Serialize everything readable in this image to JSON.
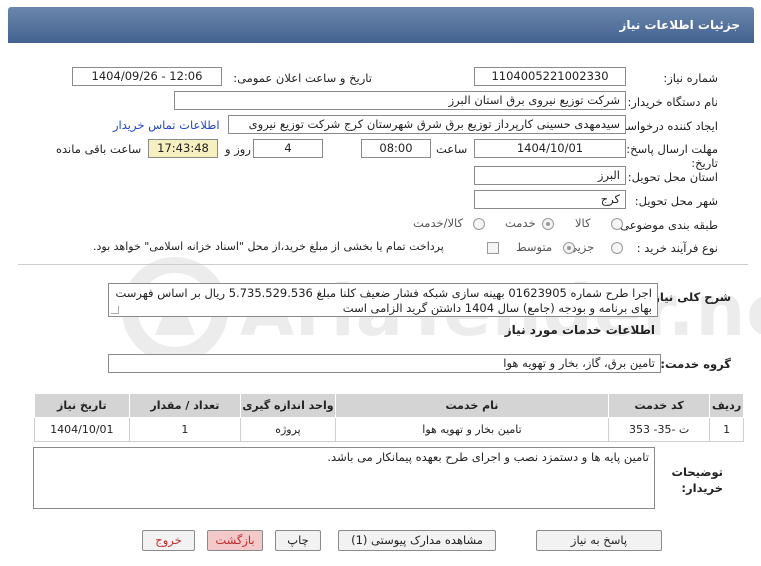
{
  "header": {
    "title": "جزئیات اطلاعات نیاز"
  },
  "fields": {
    "need_number_label": "شماره نیاز:",
    "need_number": "1104005221002330",
    "announce_label": "تاریخ و ساعت اعلان عمومی:",
    "announce_value": "1404/09/26 - 12:06",
    "buyer_org_label": "نام دستگاه خریدار:",
    "buyer_org": "شرکت توزیع نیروی برق استان البرز",
    "creator_label": "ایجاد کننده درخواست:",
    "creator": "سیدمهدی حسینی کارپرداز توزیع برق شرق شهرستان کرج شرکت توزیع نیروی",
    "contact_link": "اطلاعات تماس خریدار",
    "deadline_label": "مهلت ارسال پاسخ: تا تاریخ:",
    "deadline_date": "1404/10/01",
    "time_label": "ساعت",
    "deadline_time": "08:00",
    "days_value": "4",
    "days_label": "روز و",
    "remaining_time": "17:43:48",
    "remaining_label": "ساعت باقی مانده",
    "province_label": "استان محل تحویل:",
    "province": "البرز",
    "city_label": "شهر محل تحویل:",
    "city": "کرج",
    "category_label": "طبقه بندی موضوعی:",
    "category_options": [
      "کالا",
      "خدمت",
      "کالا/خدمت"
    ],
    "process_label": "نوع فرآیند خرید :",
    "process_options": [
      "جزیی",
      "متوسط"
    ],
    "payment_note": "پرداخت تمام یا بخشی از مبلغ خرید،از محل \"اسناد خزانه اسلامی\" خواهد بود."
  },
  "description": {
    "label": "شرح کلی نیاز:",
    "text": "اجرا طرح شماره 01623905 بهینه سازی شبکه فشار ضعیف کلنا مبلغ 5.735.529.536 ریال بر اساس فهرست بهای برنامه و بودجه (جامع) سال 1404 داشتن گرید الزامی است"
  },
  "services": {
    "section_title": "اطلاعات خدمات مورد نیاز",
    "group_label": "گروه خدمت:",
    "group_value": "تامین برق، گاز، بخار و تهویه هوا",
    "columns": [
      "ردیف",
      "کد خدمت",
      "نام خدمت",
      "واحد اندازه گیری",
      "تعداد / مقدار",
      "تاریخ نیاز"
    ],
    "rows": [
      [
        "1",
        "ت -35- 353",
        "تامین بخار و تهویه هوا",
        "پروژه",
        "1",
        "1404/10/01"
      ]
    ]
  },
  "buyer_notes": {
    "label": "توضیحات خریدار:",
    "text": "تامین پایه ها و دستمزد نصب و اجرای طرح بعهده پیمانکار می باشد."
  },
  "buttons": {
    "reply": "پاسخ به نیاز",
    "attachments": "مشاهده مدارک پیوستی (1)",
    "print": "چاپ",
    "back": "بازگشت",
    "exit": "خروج"
  },
  "watermark": {
    "text": "AriaTender.net"
  },
  "colors": {
    "header": "#4e6c98",
    "link": "#1f47c6",
    "remaining_bg": "#f6efc0",
    "red_button": "#f3c9c9"
  }
}
